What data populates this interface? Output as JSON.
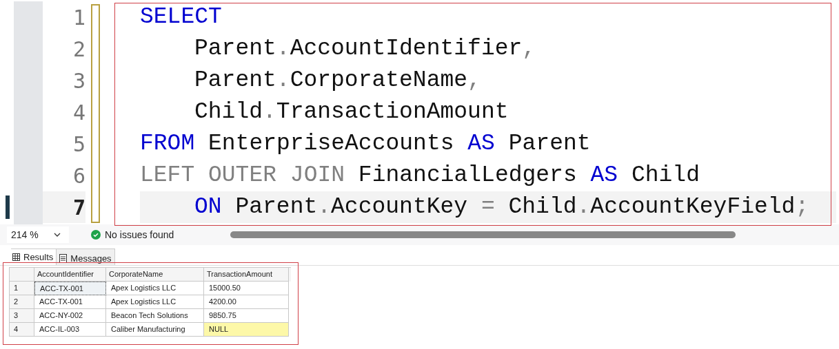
{
  "editor": {
    "lines": [
      {
        "number": "1",
        "current": false,
        "indented": false,
        "tokens": [
          {
            "kind": "keyword",
            "text": "SELECT"
          }
        ]
      },
      {
        "number": "2",
        "current": false,
        "indented": true,
        "tokens": [
          {
            "kind": "ident",
            "text": "Parent"
          },
          {
            "kind": "punct",
            "text": "."
          },
          {
            "kind": "ident",
            "text": "AccountIdentifier"
          },
          {
            "kind": "punct",
            "text": ","
          }
        ]
      },
      {
        "number": "3",
        "current": false,
        "indented": true,
        "tokens": [
          {
            "kind": "ident",
            "text": "Parent"
          },
          {
            "kind": "punct",
            "text": "."
          },
          {
            "kind": "ident",
            "text": "CorporateName"
          },
          {
            "kind": "punct",
            "text": ","
          }
        ]
      },
      {
        "number": "4",
        "current": false,
        "indented": true,
        "tokens": [
          {
            "kind": "ident",
            "text": "Child"
          },
          {
            "kind": "punct",
            "text": "."
          },
          {
            "kind": "ident",
            "text": "TransactionAmount"
          }
        ]
      },
      {
        "number": "5",
        "current": false,
        "indented": false,
        "tokens": [
          {
            "kind": "keyword",
            "text": "FROM "
          },
          {
            "kind": "ident",
            "text": "EnterpriseAccounts "
          },
          {
            "kind": "keyword",
            "text": "AS "
          },
          {
            "kind": "ident",
            "text": "Parent"
          }
        ]
      },
      {
        "number": "6",
        "current": false,
        "indented": false,
        "tokens": [
          {
            "kind": "operator",
            "text": "LEFT OUTER JOIN "
          },
          {
            "kind": "ident",
            "text": "FinancialLedgers "
          },
          {
            "kind": "keyword",
            "text": "AS "
          },
          {
            "kind": "ident",
            "text": "Child"
          }
        ]
      },
      {
        "number": "7",
        "current": true,
        "indented": true,
        "tokens": [
          {
            "kind": "keyword",
            "text": "ON "
          },
          {
            "kind": "ident",
            "text": "Parent"
          },
          {
            "kind": "punct",
            "text": "."
          },
          {
            "kind": "ident",
            "text": "AccountKey "
          },
          {
            "kind": "punct",
            "text": "= "
          },
          {
            "kind": "ident",
            "text": "Child"
          },
          {
            "kind": "punct",
            "text": "."
          },
          {
            "kind": "ident",
            "text": "AccountKeyField"
          },
          {
            "kind": "punct",
            "text": ";"
          }
        ]
      }
    ]
  },
  "status_bar": {
    "zoom": "214 %",
    "issues": "No issues found"
  },
  "tabs": [
    {
      "label": "Results",
      "selected": true
    },
    {
      "label": "Messages",
      "selected": false
    }
  ],
  "table": {
    "columns": [
      "AccountIdentifier",
      "CorporateName",
      "TransactionAmount"
    ],
    "rows": [
      {
        "number": "1",
        "cells": [
          {
            "text": "ACC-TX-001",
            "selected": true,
            "highlighted": false
          },
          {
            "text": "Apex Logistics LLC",
            "selected": false,
            "highlighted": false
          },
          {
            "text": "15000.50",
            "selected": false,
            "highlighted": false
          }
        ]
      },
      {
        "number": "2",
        "cells": [
          {
            "text": "ACC-TX-001",
            "selected": false,
            "highlighted": false
          },
          {
            "text": "Apex Logistics LLC",
            "selected": false,
            "highlighted": false
          },
          {
            "text": "4200.00",
            "selected": false,
            "highlighted": false
          }
        ]
      },
      {
        "number": "3",
        "cells": [
          {
            "text": "ACC-NY-002",
            "selected": false,
            "highlighted": false
          },
          {
            "text": "Beacon Tech Solutions",
            "selected": false,
            "highlighted": false
          },
          {
            "text": "9850.75",
            "selected": false,
            "highlighted": false
          }
        ]
      },
      {
        "number": "4",
        "cells": [
          {
            "text": "ACC-IL-003",
            "selected": false,
            "highlighted": false
          },
          {
            "text": "Caliber Manufacturing",
            "selected": false,
            "highlighted": false
          },
          {
            "text": "NULL",
            "selected": false,
            "highlighted": true
          }
        ]
      }
    ]
  }
}
